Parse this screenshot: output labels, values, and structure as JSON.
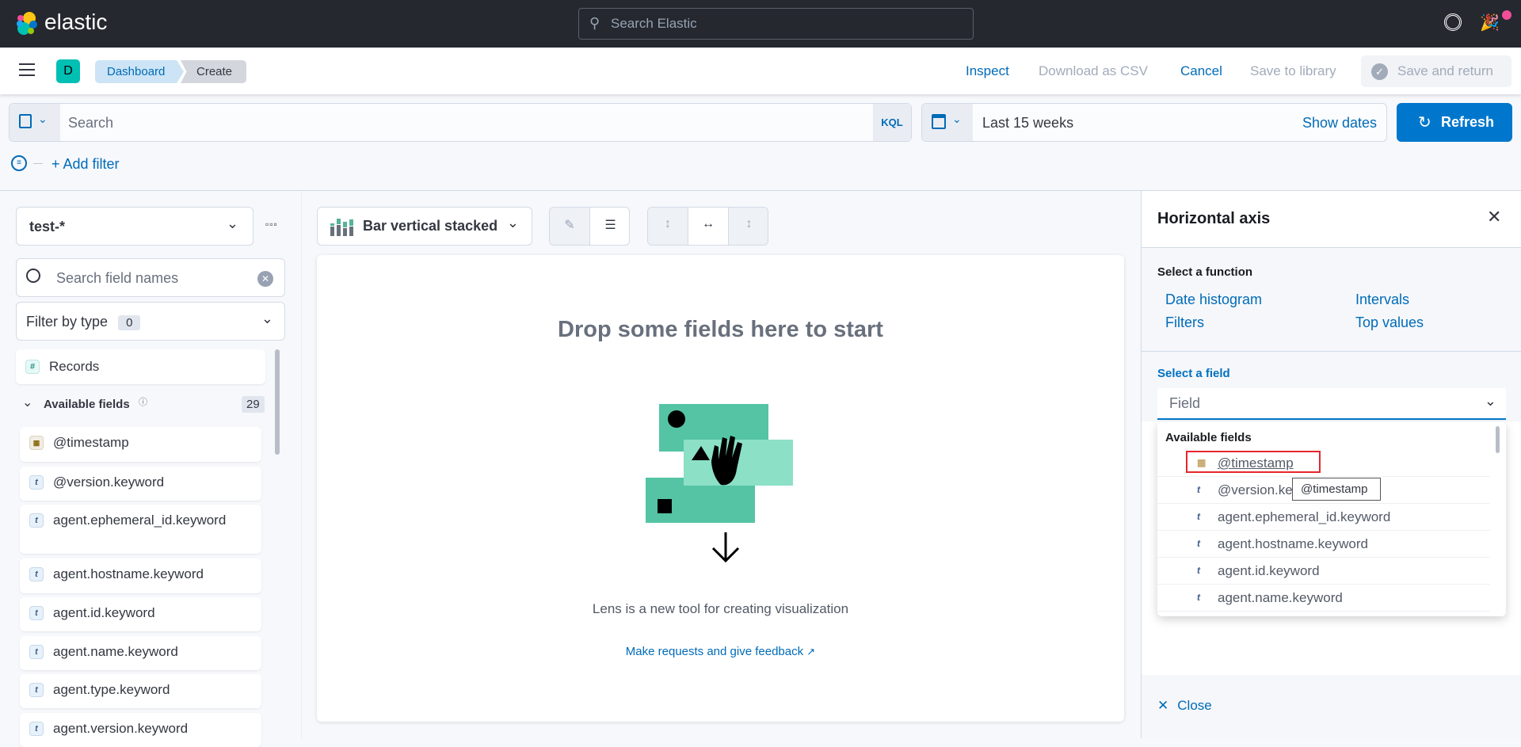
{
  "topbar": {
    "brand": "elastic",
    "search_placeholder": "Search Elastic"
  },
  "header": {
    "avatar": "D",
    "breadcrumbs": [
      "Dashboard",
      "Create"
    ],
    "inspect": "Inspect",
    "download_csv": "Download as CSV",
    "cancel": "Cancel",
    "save_library": "Save to library",
    "save_return": "Save and return"
  },
  "query": {
    "search_placeholder": "Search",
    "language": "KQL",
    "date_range": "Last 15 weeks",
    "show_dates": "Show dates",
    "refresh": "Refresh",
    "add_filter": "+ Add filter"
  },
  "sidebar": {
    "index_pattern": "test-*",
    "search_placeholder": "Search field names",
    "filter_by_type": "Filter by type",
    "filter_count": "0",
    "records": "Records",
    "available_fields": "Available fields",
    "available_count": "29",
    "fields": [
      {
        "name": "@timestamp",
        "type": "date"
      },
      {
        "name": "@version.keyword",
        "type": "t"
      },
      {
        "name": "agent.ephemeral_id.keyword",
        "type": "t"
      },
      {
        "name": "agent.hostname.keyword",
        "type": "t"
      },
      {
        "name": "agent.id.keyword",
        "type": "t"
      },
      {
        "name": "agent.name.keyword",
        "type": "t"
      },
      {
        "name": "agent.type.keyword",
        "type": "t"
      },
      {
        "name": "agent.version.keyword",
        "type": "t"
      }
    ]
  },
  "workspace": {
    "chart_type": "Bar vertical stacked",
    "empty_title": "Drop some fields here to start",
    "caption": "Lens is a new tool for creating visualization",
    "feedback_link": "Make requests and give feedback"
  },
  "panel": {
    "title": "Horizontal axis",
    "select_function": "Select a function",
    "functions": [
      "Date histogram",
      "Intervals",
      "Filters",
      "Top values"
    ],
    "select_field": "Select a field",
    "field_placeholder": "Field",
    "dropdown_group": "Available fields",
    "dropdown_fields": [
      "@timestamp",
      "@version.keyword",
      "agent.ephemeral_id.keyword",
      "agent.hostname.keyword",
      "agent.id.keyword",
      "agent.name.keyword"
    ],
    "tooltip": "@timestamp",
    "close": "Close"
  },
  "colors": {
    "primary": "#0077cc",
    "topbar": "#25282f",
    "highlight_box": "#e7262c",
    "accent": "#54c4a4"
  }
}
